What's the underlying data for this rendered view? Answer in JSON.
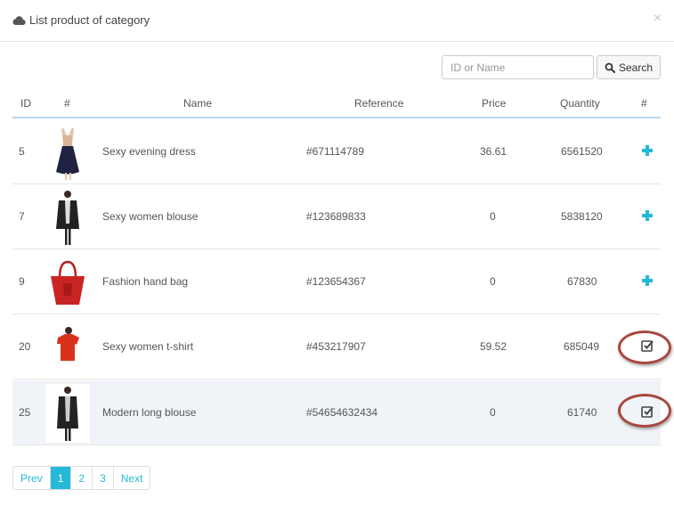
{
  "modal": {
    "title": "List product of category",
    "close": "×"
  },
  "search": {
    "placeholder": "ID or Name",
    "button_label": "Search"
  },
  "table": {
    "headers": {
      "id": "ID",
      "image": "#",
      "name": "Name",
      "reference": "Reference",
      "price": "Price",
      "quantity": "Quantity",
      "action": "#"
    },
    "rows": [
      {
        "id": "5",
        "image": "black evening dress",
        "name": "Sexy evening dress",
        "reference": "#671114789",
        "price": "36.61",
        "quantity": "6561520",
        "action": "add"
      },
      {
        "id": "7",
        "image": "woman in black blouse",
        "name": "Sexy women blouse",
        "reference": "#123689833",
        "price": "0",
        "quantity": "5838120",
        "action": "add"
      },
      {
        "id": "9",
        "image": "red hand bag",
        "name": "Fashion hand bag",
        "reference": "#123654367",
        "price": "0",
        "quantity": "67830",
        "action": "add"
      },
      {
        "id": "20",
        "image": "red t-shirt",
        "name": "Sexy women t-shirt",
        "reference": "#453217907",
        "price": "59.52",
        "quantity": "685049",
        "action": "selected"
      },
      {
        "id": "25",
        "image": "woman in long black blouse",
        "name": "Modern long blouse",
        "reference": "#54654632434",
        "price": "0",
        "quantity": "61740",
        "action": "selected"
      }
    ]
  },
  "pagination": {
    "prev": "Prev",
    "pages": [
      "1",
      "2",
      "3"
    ],
    "active_page": "1",
    "next": "Next"
  },
  "colors": {
    "accent": "#25b9d7",
    "header_border": "#b7d8ea",
    "highlight_row": "#f0f3f7",
    "annotation_ring": "#a8473c"
  },
  "icons": {
    "title": "cloud-icon",
    "close": "close-icon",
    "search": "magnifier-icon",
    "add": "plus-icon",
    "selected": "checkbox-checked-icon"
  }
}
